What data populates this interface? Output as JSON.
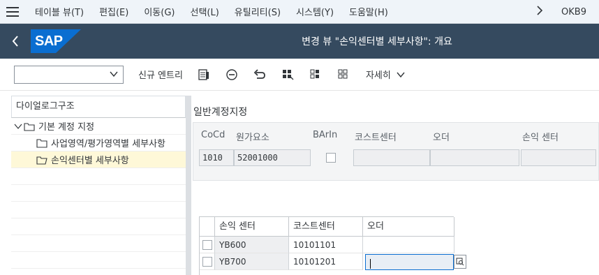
{
  "menu": {
    "items": [
      "테이블 뷰(T)",
      "편집(E)",
      "이동(G)",
      "선택(L)",
      "유틸리티(S)",
      "시스템(Y)",
      "도움말(H)"
    ],
    "tcode": "OKB9"
  },
  "titlebar": {
    "logo_text": "SAP",
    "title": "변경 뷰 \"손익센터별 세부사항\": 개요"
  },
  "toolbar": {
    "command_value": "",
    "new_entries_label": "신규 엔트리",
    "more_label": "자세히"
  },
  "dialog_structure": {
    "header": "다이얼로그구조",
    "items": [
      {
        "label": "기본 계정 지정"
      },
      {
        "label": "사업영역/평가영역별 세부사항"
      },
      {
        "label": "손익센터별 세부사항"
      }
    ]
  },
  "account_assignment": {
    "section_title": "일반계정지정",
    "labels": {
      "cocd": "CoCd",
      "cost_element": "원가요소",
      "barin": "BArIn",
      "cost_center": "코스트센터",
      "order": "오더",
      "profit_center": "손익 센터"
    },
    "values": {
      "cocd": "1010",
      "cost_element": "52001000",
      "cost_center": "",
      "order": "",
      "profit_center": ""
    }
  },
  "table": {
    "columns": [
      "손익 센터",
      "코스트센터",
      "오더"
    ],
    "rows": [
      {
        "profit_center": "YB600",
        "cost_center": "10101101",
        "order": ""
      },
      {
        "profit_center": "YB700",
        "cost_center": "10101201",
        "order": ""
      }
    ]
  },
  "colors": {
    "titlebar_bg": "#354a5f",
    "menubar_bg": "#eff4f9",
    "selection_bg": "#fef8d8",
    "accent": "#0a6ed1"
  }
}
